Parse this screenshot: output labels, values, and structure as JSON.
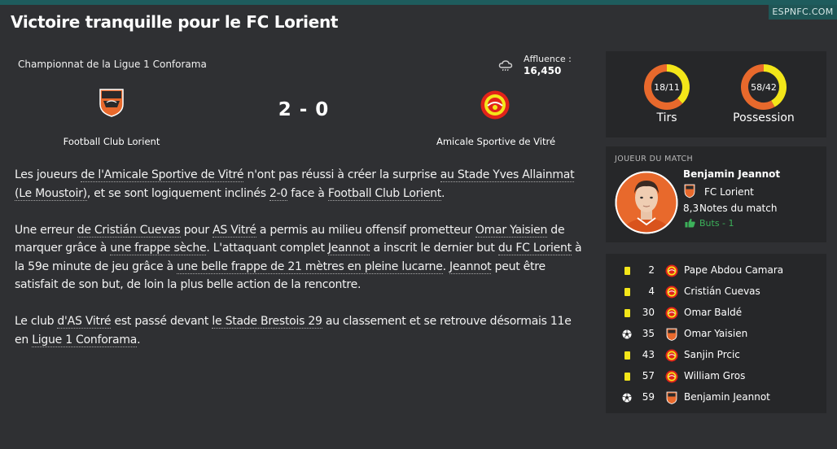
{
  "header": {
    "title": "Victoire tranquille pour le FC Lorient",
    "source": "ESPNFC.COM"
  },
  "match": {
    "competition": "Championnat de la Ligue 1 Conforama",
    "attendance_label": "Affluence :",
    "attendance_value": "16,450",
    "score": "2 - 0",
    "home_team": "Football Club Lorient",
    "away_team": "Amicale Sportive de Vitré"
  },
  "report": {
    "p1": [
      {
        "t": "Les joueurs "
      },
      {
        "t": "de l'Amicale Sportive de Vitré",
        "link": true
      },
      {
        "t": " n'ont pas réussi à créer la surprise "
      },
      {
        "t": "au Stade Yves Allainmat (Le Moustoir)",
        "link": true
      },
      {
        "t": ", et se sont logiquement inclinés "
      },
      {
        "t": "2-0",
        "link": true
      },
      {
        "t": " face à "
      },
      {
        "t": "Football Club Lorient",
        "link": true
      },
      {
        "t": "."
      }
    ],
    "p2": [
      {
        "t": "Une erreur "
      },
      {
        "t": "de Cristián Cuevas",
        "link": true
      },
      {
        "t": " pour "
      },
      {
        "t": "AS Vitré",
        "link": true
      },
      {
        "t": " a permis au milieu offensif prometteur "
      },
      {
        "t": "Omar Yaisien",
        "link": true
      },
      {
        "t": " de marquer grâce à "
      },
      {
        "t": "une frappe sèche",
        "link": true
      },
      {
        "t": ". L'attaquant complet "
      },
      {
        "t": "Jeannot",
        "link": true
      },
      {
        "t": " a inscrit le dernier but "
      },
      {
        "t": "du FC Lorient",
        "link": true
      },
      {
        "t": " à la 59e minute de jeu grâce à "
      },
      {
        "t": "une belle frappe de 21 mètres en pleine lucarne",
        "link": true
      },
      {
        "t": ". "
      },
      {
        "t": "Jeannot",
        "link": true
      },
      {
        "t": " peut être satisfait de son but, de loin la plus belle action de la rencontre."
      }
    ],
    "p3": [
      {
        "t": "Le club "
      },
      {
        "t": "d'AS Vitré",
        "link": true
      },
      {
        "t": " est passé devant "
      },
      {
        "t": "le Stade Brestois 29",
        "link": true
      },
      {
        "t": " au classement et se retrouve désormais 11e en "
      },
      {
        "t": "Ligue 1 Conforama",
        "link": true
      },
      {
        "t": "."
      }
    ]
  },
  "stats": [
    {
      "name": "stat-shots",
      "label": "Tirs",
      "display": "18/11",
      "home": 18,
      "away": 11
    },
    {
      "name": "stat-possession",
      "label": "Possession",
      "display": "58/42",
      "home": 58,
      "away": 42
    }
  ],
  "motm": {
    "header": "JOUEUR DU MATCH",
    "name": "Benjamin Jeannot",
    "club": "FC Lorient",
    "rating": "8,3",
    "rating_label": "Notes du match",
    "goals": "Buts - 1"
  },
  "events": [
    {
      "minute": "2",
      "player": "Pape Abdou Camara",
      "type": "yellow-card",
      "team": "away"
    },
    {
      "minute": "4",
      "player": "Cristián Cuevas",
      "type": "yellow-card",
      "team": "away"
    },
    {
      "minute": "30",
      "player": "Omar Baldé",
      "type": "yellow-card",
      "team": "away"
    },
    {
      "minute": "35",
      "player": "Omar Yaisien",
      "type": "goal",
      "team": "home"
    },
    {
      "minute": "43",
      "player": "Sanjin Prcic",
      "type": "yellow-card",
      "team": "away"
    },
    {
      "minute": "57",
      "player": "William Gros",
      "type": "yellow-card",
      "team": "away"
    },
    {
      "minute": "59",
      "player": "Benjamin Jeannot",
      "type": "goal",
      "team": "home"
    }
  ],
  "colors": {
    "home": "#e8692c",
    "away": "#f3e619",
    "card": "#f3e619",
    "goals_text": "#3cb15a",
    "link_underline": "#a8a8a8"
  }
}
